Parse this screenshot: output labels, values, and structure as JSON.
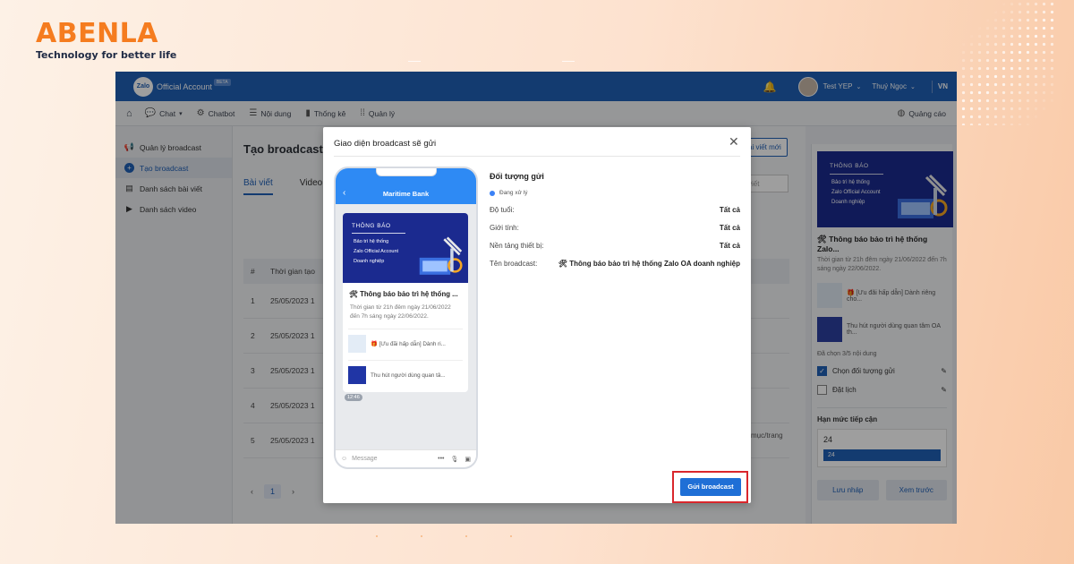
{
  "brand": {
    "name": "ABENLA",
    "tagline": "Technology for better life"
  },
  "topbar": {
    "logo_text": "Zalo",
    "title": "Official Account",
    "beta": "BETA",
    "user": "Test YEP",
    "account": "Thuý Ngọc",
    "language": "VN"
  },
  "nav": {
    "items": [
      {
        "label": "Chat",
        "icon": "chat-icon"
      },
      {
        "label": "Chatbot",
        "icon": "chatbot-icon"
      },
      {
        "label": "Nội dung",
        "icon": "list-icon"
      },
      {
        "label": "Thống kê",
        "icon": "chart-icon"
      },
      {
        "label": "Quản lý",
        "icon": "grid-icon"
      }
    ],
    "right": "Quảng cáo"
  },
  "sidebar": {
    "items": [
      {
        "label": "Quản lý broadcast",
        "icon": "megaphone-icon"
      },
      {
        "label": "Tạo broadcast",
        "icon": "plus-icon",
        "active": true
      },
      {
        "label": "Danh sách bài viết",
        "icon": "document-icon"
      },
      {
        "label": "Danh sách video",
        "icon": "video-icon"
      }
    ]
  },
  "main": {
    "title": "Tạo broadcast",
    "tabs": [
      "Bài viết",
      "Video"
    ],
    "new_post": "ài viết mới",
    "search_stub": "viết",
    "table_head": [
      "#",
      "Thời gian tạo"
    ],
    "rows": [
      {
        "num": "1",
        "time": "25/05/2023 1"
      },
      {
        "num": "2",
        "time": "25/05/2023 1"
      },
      {
        "num": "3",
        "time": "25/05/2023 1"
      },
      {
        "num": "4",
        "time": "25/05/2023 1"
      },
      {
        "num": "5",
        "time": "25/05/2023 1"
      }
    ],
    "page": "1",
    "per_page": "mục/trang"
  },
  "right_panel": {
    "banner_tag": "THÔNG BÁO",
    "banner_lines": [
      "Bảo trì hệ thống",
      "Zalo Official Account",
      "Doanh nghiệp"
    ],
    "post_title": "🛠 Thông báo bảo trì hệ thống Zalo...",
    "post_desc": "Thời gian từ 21h đêm ngày 21/06/2022 đến 7h sáng ngày 22/06/2022.",
    "sub_items": [
      "🎁 [Ưu đãi hấp dẫn] Dành riêng cho...",
      "Thu hút người dùng quan tâm OA th..."
    ],
    "selected_count": "Đã chọn 3/5 nội dung",
    "options": [
      {
        "label": "Chọn đối tượng gửi",
        "checked": true
      },
      {
        "label": "Đặt lịch",
        "checked": false
      }
    ],
    "limit_title": "Hạn mức tiếp cận",
    "limit_value": "24",
    "limit_bar": "24",
    "buttons": [
      "Lưu nháp",
      "Xem trước"
    ]
  },
  "modal": {
    "title": "Giao diện broadcast sẽ gửi",
    "close": "✕",
    "phone": {
      "name": "Maritime Bank",
      "banner_tag": "THÔNG BÁO",
      "banner_lines": [
        "Bảo trì hệ thống",
        "Zalo Official Account",
        "Doanh nghiệp"
      ],
      "post_title": "🛠 Thông báo bảo trì hệ thống ...",
      "post_desc": "Thời gian từ 21h đêm ngày 21/06/2022 đến 7h sáng ngày 22/06/2022.",
      "sub_items": [
        "🎁 [Ưu đãi hấp dẫn] Dành ri...",
        "Thu hút người dùng quan tâ..."
      ],
      "time": "12:46",
      "input_placeholder": "Message"
    },
    "info": {
      "heading": "Đối tượng gửi",
      "status": "Đang xử lý",
      "rows": [
        {
          "label": "Độ tuổi:",
          "value": "Tất cả"
        },
        {
          "label": "Giới tính:",
          "value": "Tất cả"
        },
        {
          "label": "Nền tảng thiết bị:",
          "value": "Tất cả"
        },
        {
          "label": "Tên broadcast:",
          "value": "🛠 Thông báo bảo trì hệ thống Zalo OA doanh nghiệp"
        }
      ]
    },
    "send_button": "Gửi broadcast"
  },
  "colors": {
    "primary": "#1f5fb5",
    "brand_orange": "#f57c1f",
    "highlight": "#d9262c"
  }
}
